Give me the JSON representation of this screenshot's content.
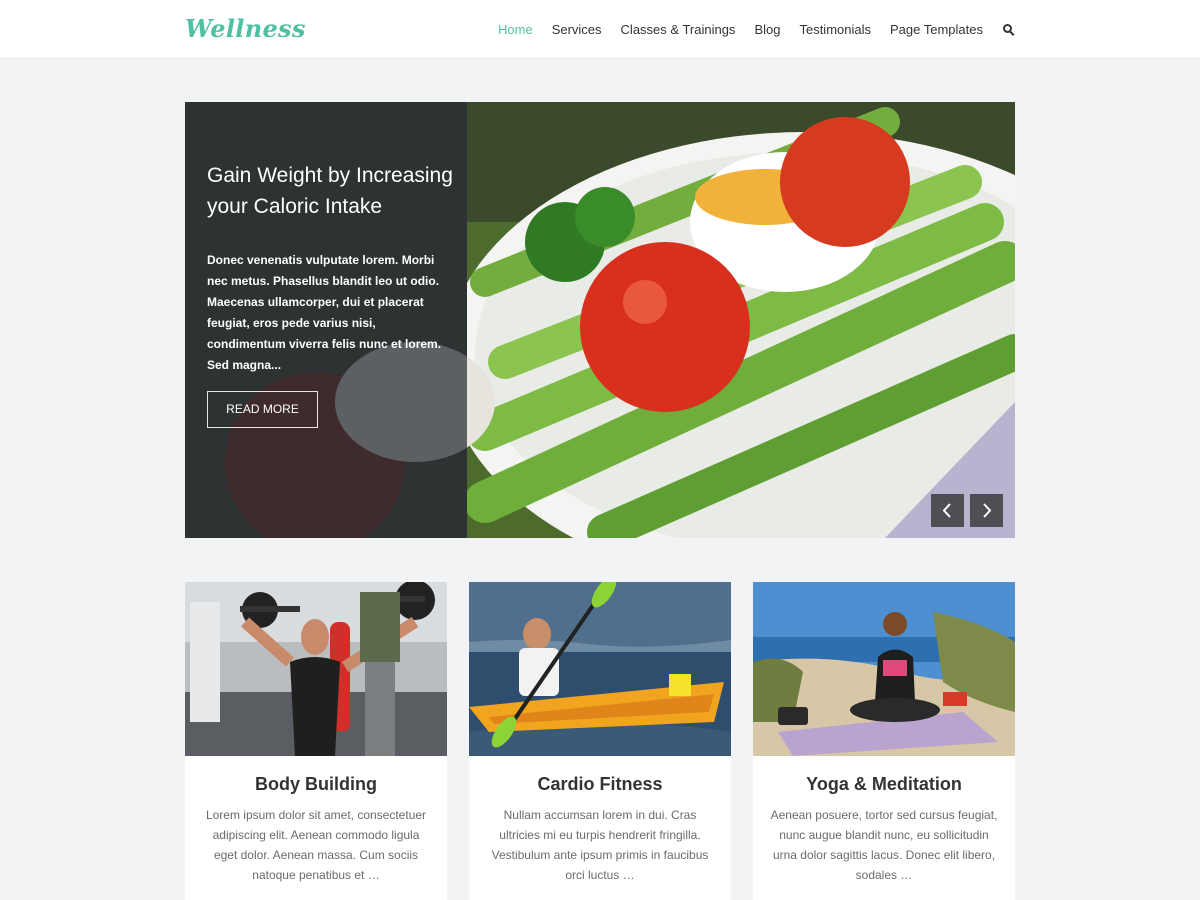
{
  "site": {
    "logo": "Wellness",
    "accent_color": "#4fc1a3"
  },
  "nav": {
    "items": [
      {
        "label": "Home",
        "active": true
      },
      {
        "label": "Services",
        "active": false
      },
      {
        "label": "Classes & Trainings",
        "active": false
      },
      {
        "label": "Blog",
        "active": false
      },
      {
        "label": "Testimonials",
        "active": false
      },
      {
        "label": "Page Templates",
        "active": false
      }
    ],
    "search_icon": "search-icon"
  },
  "hero": {
    "title": "Gain Weight by Increasing your Caloric Intake",
    "excerpt": "Donec venenatis vulputate lorem. Morbi nec metus. Phasellus blandit leo ut odio. Maecenas ullamcorper, dui et placerat feugiat, eros pede varius nisi, condimentum viverra felis nunc et lorem. Sed magna...",
    "button_label": "READ MORE",
    "prev_icon": "chevron-left-icon",
    "next_icon": "chevron-right-icon"
  },
  "cards": [
    {
      "title": "Body Building",
      "text": "Lorem ipsum dolor sit amet, consectetuer adipiscing elit. Aenean commodo ligula eget dolor. Aenean massa. Cum sociis natoque penatibus et …"
    },
    {
      "title": "Cardio Fitness",
      "text": "Nullam accumsan lorem in dui. Cras ultricies mi eu turpis hendrerit fringilla. Vestibulum ante ipsum primis in faucibus orci luctus …"
    },
    {
      "title": "Yoga & Meditation",
      "text": "Aenean posuere, tortor sed cursus feugiat, nunc augue blandit nunc, eu sollicitudin urna dolor sagittis lacus. Donec elit libero, sodales …"
    }
  ]
}
